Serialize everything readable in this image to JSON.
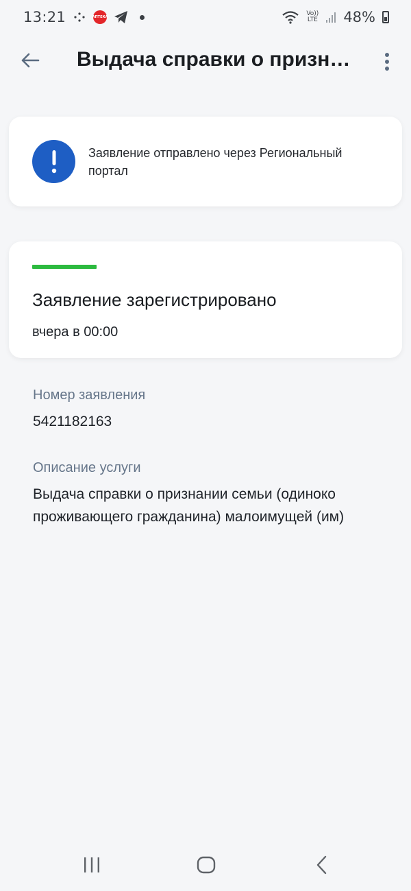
{
  "status_bar": {
    "time": "13:21",
    "battery": "48%",
    "volte_top": "Vo))",
    "volte_bottom": "LTE",
    "apteka_label": "АПТЕКА"
  },
  "header": {
    "title": "Выдача справки о призна…",
    "back_icon": "arrow-left-icon",
    "more_icon": "more-vert-icon"
  },
  "info_card": {
    "icon": "exclamation-icon",
    "icon_color": "#1e5ec4",
    "text": "Заявление отправлено через Региональный портал"
  },
  "status_card": {
    "accent_color": "#2cba3f",
    "title": "Заявление зарегистрировано",
    "time": "вчера в 00:00"
  },
  "details": {
    "number_label": "Номер заявления",
    "number_value": "5421182163",
    "description_label": "Описание услуги",
    "description_value": "Выдача справки о признании семьи (одиноко проживающего гражданина) малоимущей (им)"
  },
  "nav": {
    "recent_icon": "recent-apps-icon",
    "home_icon": "home-icon",
    "back_icon": "back-icon"
  }
}
